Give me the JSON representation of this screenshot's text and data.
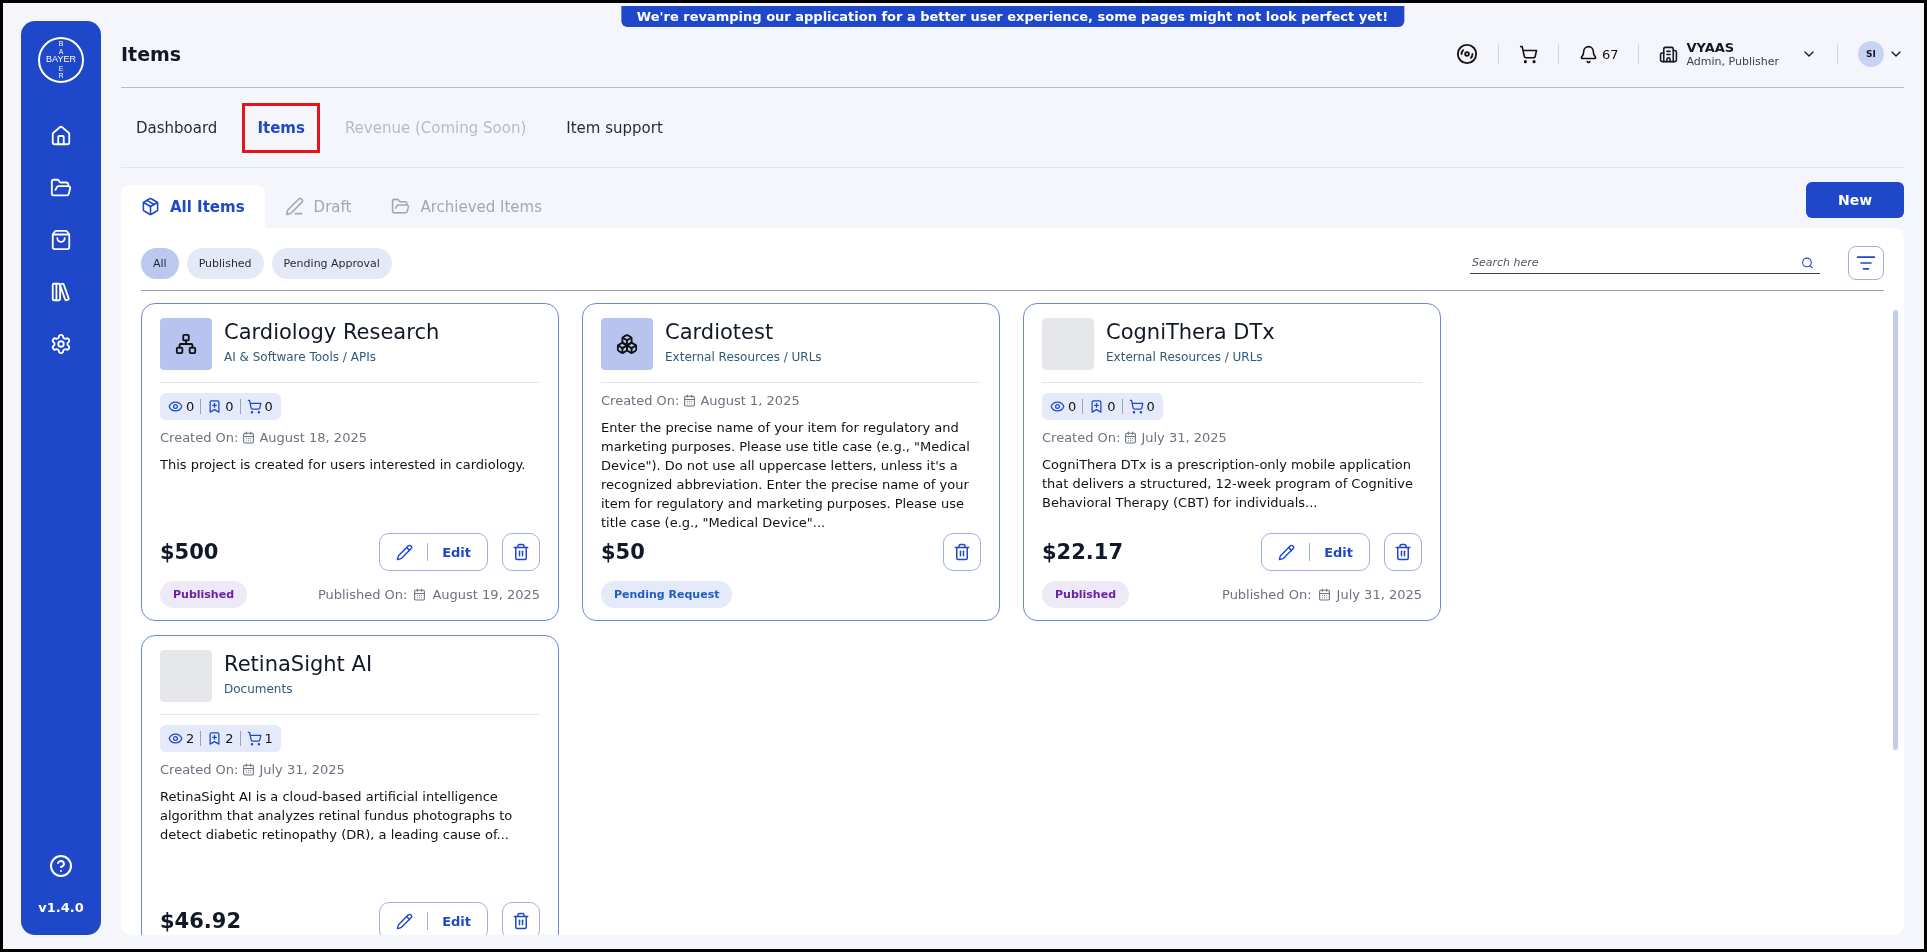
{
  "banner": "We're revamping our application for a better user experience, some pages might not look perfect yet!",
  "sidebar": {
    "logo": {
      "horizontal": "BAYER",
      "vertical_top": "BA",
      "vertical_bottom": "ER"
    },
    "items": [
      {
        "kind": "home"
      },
      {
        "kind": "folder"
      },
      {
        "kind": "bag"
      },
      {
        "kind": "library"
      },
      {
        "kind": "settings"
      }
    ],
    "version": "v1.4.0"
  },
  "header": {
    "title": "Items",
    "notifications": "67",
    "org": {
      "name": "VYAAS",
      "roles": "Admin, Publisher"
    },
    "avatar": "SI"
  },
  "nav_tabs": [
    {
      "label": "Dashboard",
      "selected": false,
      "disabled": false,
      "highlighted": false
    },
    {
      "label": "Items",
      "selected": true,
      "disabled": false,
      "highlighted": true
    },
    {
      "label": "Revenue (Coming Soon)",
      "selected": false,
      "disabled": true,
      "highlighted": false
    },
    {
      "label": "Item support",
      "selected": false,
      "disabled": false,
      "highlighted": false
    }
  ],
  "sub_tabs": [
    {
      "label": "All Items",
      "kind": "package",
      "selected": true
    },
    {
      "label": "Draft",
      "kind": "pen",
      "selected": false
    },
    {
      "label": "Archieved Items",
      "kind": "folder",
      "selected": false
    }
  ],
  "new_button": "New",
  "filters": [
    {
      "label": "All",
      "selected": true
    },
    {
      "label": "Published",
      "selected": false
    },
    {
      "label": "Pending Approval",
      "selected": false
    }
  ],
  "search": {
    "placeholder": "Search here"
  },
  "cards": [
    {
      "kind": "network",
      "title": "Cardiology Research",
      "category": "AI & Software Tools / APIs",
      "stats": [
        {
          "kind": "views",
          "value": "0"
        },
        {
          "kind": "saves",
          "value": "0"
        },
        {
          "kind": "carts",
          "value": "0"
        }
      ],
      "created_label": "Created On:",
      "created_date": "August 18, 2025",
      "description": "This project is created for users interested in cardiology.",
      "price": "$500",
      "edit": "Edit",
      "status": {
        "label": "Published",
        "kind": "published"
      },
      "published_label": "Published On:",
      "published_date": "August 19, 2025"
    },
    {
      "kind": "boxes",
      "title": "Cardiotest",
      "category": "External Resources / URLs",
      "created_label": "Created On:",
      "created_date": "August 1, 2025",
      "description": "Enter the precise name of your item for regulatory and marketing purposes. Please use title case (e.g., \"Medical Device\"). Do not use all uppercase letters, unless it's a recognized abbreviation. Enter the precise name of your item for regulatory and marketing purposes. Please use title case (e.g., \"Medical Device\"...",
      "price": "$50",
      "status": {
        "label": "Pending Request",
        "kind": "pending"
      }
    },
    {
      "kind": "photo",
      "title": "CogniThera DTx",
      "category": "External Resources / URLs",
      "stats": [
        {
          "kind": "views",
          "value": "0"
        },
        {
          "kind": "saves",
          "value": "0"
        },
        {
          "kind": "carts",
          "value": "0"
        }
      ],
      "created_label": "Created On:",
      "created_date": "July 31, 2025",
      "description": "CogniThera DTx is a prescription-only mobile application that delivers a structured, 12-week program of Cognitive Behavioral Therapy (CBT) for individuals...",
      "price": "$22.17",
      "edit": "Edit",
      "status": {
        "label": "Published",
        "kind": "published"
      },
      "published_label": "Published On:",
      "published_date": "July 31, 2025"
    },
    {
      "kind": "photo",
      "title": "RetinaSight AI",
      "category": "Documents",
      "stats": [
        {
          "kind": "views",
          "value": "2"
        },
        {
          "kind": "saves",
          "value": "2"
        },
        {
          "kind": "carts",
          "value": "1"
        }
      ],
      "created_label": "Created On:",
      "created_date": "July 31, 2025",
      "description": "RetinaSight AI is a cloud-based artificial intelligence algorithm that analyzes retinal fundus photographs to detect diabetic retinopathy (DR), a leading cause of...",
      "price": "$46.92",
      "edit": "Edit"
    }
  ]
}
